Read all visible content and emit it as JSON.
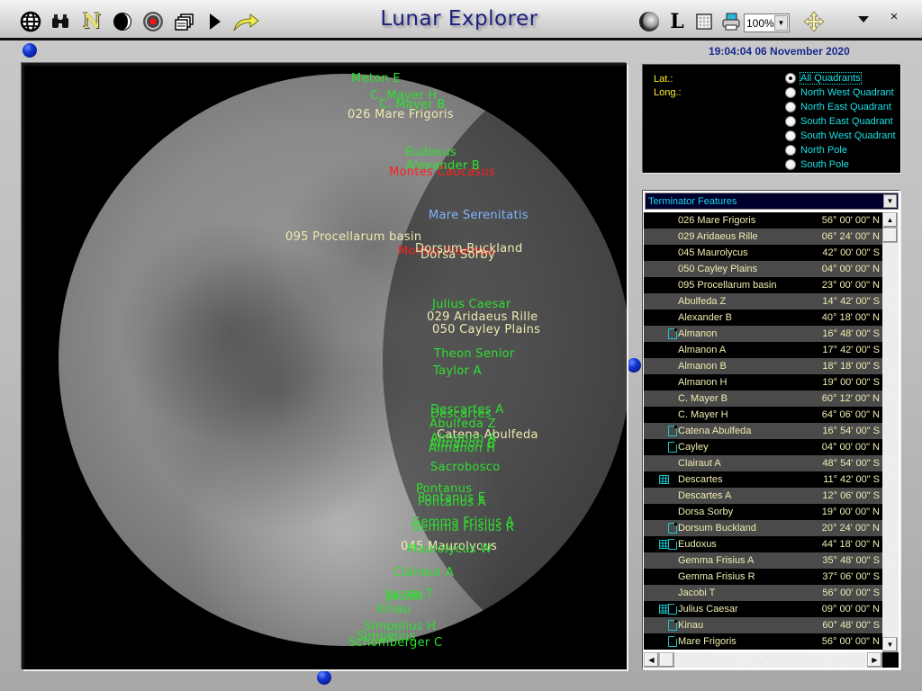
{
  "app": {
    "title": "Lunar Explorer",
    "datetime": "19:04:04  06 November 2020",
    "zoom_level": "100%"
  },
  "toolbar": {
    "left_icons": [
      "globe-icon",
      "binoculars-icon",
      "north-icon",
      "moon-phase-icon",
      "record-icon",
      "windows-icon",
      "play-icon",
      "curved-arrow-icon"
    ],
    "north_label": "N",
    "labels_button": "L",
    "right_icons": [
      "moon-icon",
      "labels-icon",
      "grid-icon",
      "printer-icon",
      "zoom-select",
      "move-icon",
      "menu-dropdown-icon",
      "close-icon"
    ],
    "close_label": "×"
  },
  "coords": {
    "lat_label": "Lat.:",
    "long_label": "Long.:"
  },
  "quadrants": {
    "selected": "All Quadrants",
    "options": [
      "All Quadrants",
      "North West Quadrant",
      "North East Quadrant",
      "South East Quadrant",
      "South West Quadrant",
      "North Pole",
      "South Pole"
    ]
  },
  "feature_list": {
    "category": "Terminator Features",
    "rows": [
      {
        "name": "026 Mare Frigoris",
        "lat": "56° 00' 00\" N",
        "icons": []
      },
      {
        "name": "029 Aridaeus Rille",
        "lat": "06° 24' 00\" N",
        "icons": []
      },
      {
        "name": "045 Maurolycus",
        "lat": "42° 00' 00\" S",
        "icons": []
      },
      {
        "name": "050 Cayley Plains",
        "lat": "04° 00' 00\" N",
        "icons": []
      },
      {
        "name": "095 Procellarum basin",
        "lat": "23° 00' 00\" N",
        "icons": []
      },
      {
        "name": "Abulfeda Z",
        "lat": "14° 42' 00\" S",
        "icons": []
      },
      {
        "name": "Alexander B",
        "lat": "40° 18' 00\" N",
        "icons": []
      },
      {
        "name": "Almanon",
        "lat": "16° 48' 00\" S",
        "icons": [
          "doc"
        ]
      },
      {
        "name": "Almanon A",
        "lat": "17° 42' 00\" S",
        "icons": []
      },
      {
        "name": "Almanon B",
        "lat": "18° 18' 00\" S",
        "icons": []
      },
      {
        "name": "Almanon H",
        "lat": "19° 00' 00\" S",
        "icons": []
      },
      {
        "name": "C. Mayer B",
        "lat": "60° 12' 00\" N",
        "icons": []
      },
      {
        "name": "C. Mayer H",
        "lat": "64° 06' 00\" N",
        "icons": []
      },
      {
        "name": "Catena Abulfeda",
        "lat": "16° 54' 00\" S",
        "icons": [
          "doc"
        ]
      },
      {
        "name": "Cayley",
        "lat": "04° 00' 00\" N",
        "icons": [
          "doc"
        ]
      },
      {
        "name": "Clairaut A",
        "lat": "48° 54' 00\" S",
        "icons": []
      },
      {
        "name": "Descartes",
        "lat": "11° 42' 00\" S",
        "icons": [
          "grid"
        ]
      },
      {
        "name": "Descartes A",
        "lat": "12° 06' 00\" S",
        "icons": []
      },
      {
        "name": "Dorsa Sorby",
        "lat": "19° 00' 00\" N",
        "icons": []
      },
      {
        "name": "Dorsum Buckland",
        "lat": "20° 24' 00\" N",
        "icons": [
          "doc"
        ]
      },
      {
        "name": "Eudoxus",
        "lat": "44° 18' 00\" N",
        "icons": [
          "grid",
          "doc"
        ]
      },
      {
        "name": "Gemma Frisius A",
        "lat": "35° 48' 00\" S",
        "icons": []
      },
      {
        "name": "Gemma Frisius R",
        "lat": "37° 06' 00\" S",
        "icons": []
      },
      {
        "name": "Jacobi T",
        "lat": "56° 00' 00\" S",
        "icons": []
      },
      {
        "name": "Julius Caesar",
        "lat": "09° 00' 00\" N",
        "icons": [
          "grid",
          "doc"
        ]
      },
      {
        "name": "Kinau",
        "lat": "60° 48' 00\" S",
        "icons": [
          "doc"
        ]
      },
      {
        "name": "Mare Frigoris",
        "lat": "56° 00' 00\" N",
        "icons": [
          "doc"
        ]
      }
    ]
  },
  "map_labels": [
    {
      "text": "Meton E",
      "color": "green"
    },
    {
      "text": "C. Mayer H",
      "color": "green"
    },
    {
      "text": "C. Mayer B",
      "color": "green"
    },
    {
      "text": "026 Mare Frigoris",
      "color": "yellow"
    },
    {
      "text": "Eudoxus",
      "color": "green"
    },
    {
      "text": "Alexander B",
      "color": "green"
    },
    {
      "text": "Montes Caucasus",
      "color": "red"
    },
    {
      "text": "Mare Serenitatis",
      "color": "blue"
    },
    {
      "text": "095 Procellarum basin",
      "color": "yellow"
    },
    {
      "text": "Montes Haemus",
      "color": "red"
    },
    {
      "text": "Dorsum Buckland",
      "color": "yellow"
    },
    {
      "text": "Dorsa Sorby",
      "color": "yellow"
    },
    {
      "text": "Julius Caesar",
      "color": "green"
    },
    {
      "text": "029 Aridaeus Rille",
      "color": "yellow"
    },
    {
      "text": "050 Cayley Plains",
      "color": "yellow"
    },
    {
      "text": "Theon Senior",
      "color": "green"
    },
    {
      "text": "Taylor A",
      "color": "green"
    },
    {
      "text": "Descartes A",
      "color": "green"
    },
    {
      "text": "Descartes",
      "color": "green"
    },
    {
      "text": "Abulfeda Z",
      "color": "green"
    },
    {
      "text": "Catena Abulfeda",
      "color": "yellow"
    },
    {
      "text": "Almanon A",
      "color": "green"
    },
    {
      "text": "Almanon B",
      "color": "green"
    },
    {
      "text": "Almanon H",
      "color": "green"
    },
    {
      "text": "Sacrobosco",
      "color": "green"
    },
    {
      "text": "Pontanus",
      "color": "green"
    },
    {
      "text": "Pontanus E",
      "color": "green"
    },
    {
      "text": "Pontanus A",
      "color": "green"
    },
    {
      "text": "Gemma Frisius A",
      "color": "green"
    },
    {
      "text": "Gemma Frisius R",
      "color": "green"
    },
    {
      "text": "045 Maurolycus",
      "color": "yellow"
    },
    {
      "text": "Maurolycus W",
      "color": "green"
    },
    {
      "text": "Clairaut A",
      "color": "green"
    },
    {
      "text": "Jacobi T",
      "color": "green"
    },
    {
      "text": "Jacobi",
      "color": "green"
    },
    {
      "text": "Kinau",
      "color": "green"
    },
    {
      "text": "Simpelius H",
      "color": "green"
    },
    {
      "text": "Simpelius",
      "color": "green"
    },
    {
      "text": "Schomberger C",
      "color": "green"
    }
  ],
  "colors": {
    "title": "#1b1f7a",
    "datetime": "#1a2a8c",
    "radio_text": "#19e0e6",
    "coord_label": "#ffee33",
    "list_text": "#f0ecb0",
    "list_icon": "#19c8d0",
    "label_green": "#2fe02f",
    "label_yellow": "#efeab0",
    "label_red": "#ff2020",
    "label_blue": "#7fb4ff"
  }
}
